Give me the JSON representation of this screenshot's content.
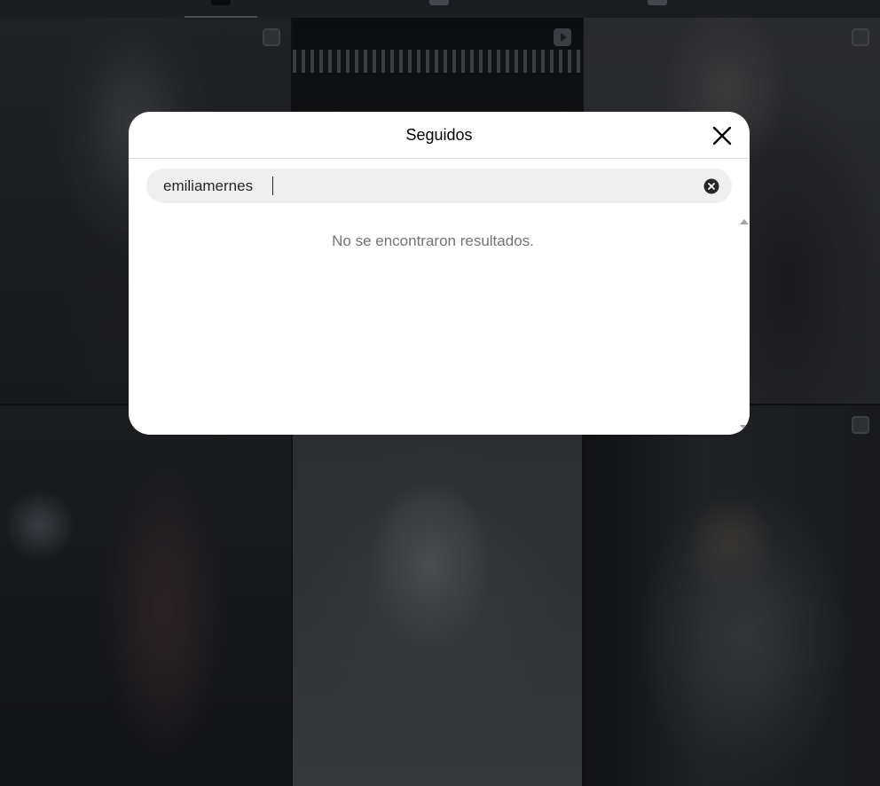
{
  "modal": {
    "title": "Seguidos",
    "search": {
      "value": "emiliamernes",
      "placeholder": ""
    },
    "empty_message": "No se encontraron resultados."
  },
  "icons": {
    "close": "close-icon",
    "clear": "clear-search-icon",
    "multi_post": "multiple-posts-icon",
    "reel": "reel-icon"
  },
  "colors": {
    "modal_background": "#ffffff",
    "search_background": "#efefef",
    "overlay": "#000000",
    "muted_text": "#737373"
  }
}
